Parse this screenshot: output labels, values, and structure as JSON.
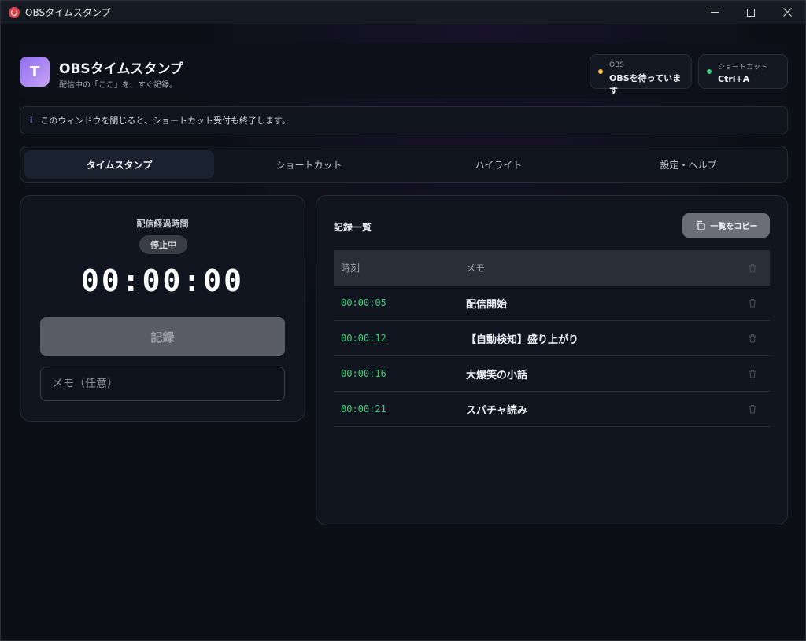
{
  "window": {
    "title": "OBSタイムスタンプ"
  },
  "header": {
    "logo_letter": "T",
    "title": "OBSタイムスタンプ",
    "subtitle": "配信中の「ここ」を、すぐ記録。",
    "obs_chip": {
      "label": "OBS",
      "value": "OBSを待っています",
      "dot_color": "#f5b942"
    },
    "shortcut_chip": {
      "label": "ショートカット",
      "value": "Ctrl+A",
      "dot_color": "#3ccf7a"
    }
  },
  "info": {
    "icon": "i",
    "text": "このウィンドウを閉じると、ショートカット受付も終了します。"
  },
  "tabs": [
    {
      "label": "タイムスタンプ",
      "active": true
    },
    {
      "label": "ショートカット",
      "active": false
    },
    {
      "label": "ハイライト",
      "active": false
    },
    {
      "label": "設定・ヘルプ",
      "active": false
    }
  ],
  "timer_panel": {
    "label": "配信経過時間",
    "status": "停止中",
    "time": "00:00:00",
    "record_label": "記録",
    "memo_placeholder": "メモ（任意）",
    "memo_value": ""
  },
  "list_panel": {
    "title": "記録一覧",
    "copy_label": "一覧をコピー",
    "columns": {
      "time": "時刻",
      "memo": "メモ"
    },
    "rows": [
      {
        "time": "00:00:05",
        "memo": "配信開始"
      },
      {
        "time": "00:00:12",
        "memo": "【自動検知】盛り上がり"
      },
      {
        "time": "00:00:16",
        "memo": "大爆笑の小話"
      },
      {
        "time": "00:00:21",
        "memo": "スパチャ読み"
      }
    ]
  },
  "colors": {
    "accent": "#8e6cf0",
    "timestamp_green": "#3fd07a"
  }
}
